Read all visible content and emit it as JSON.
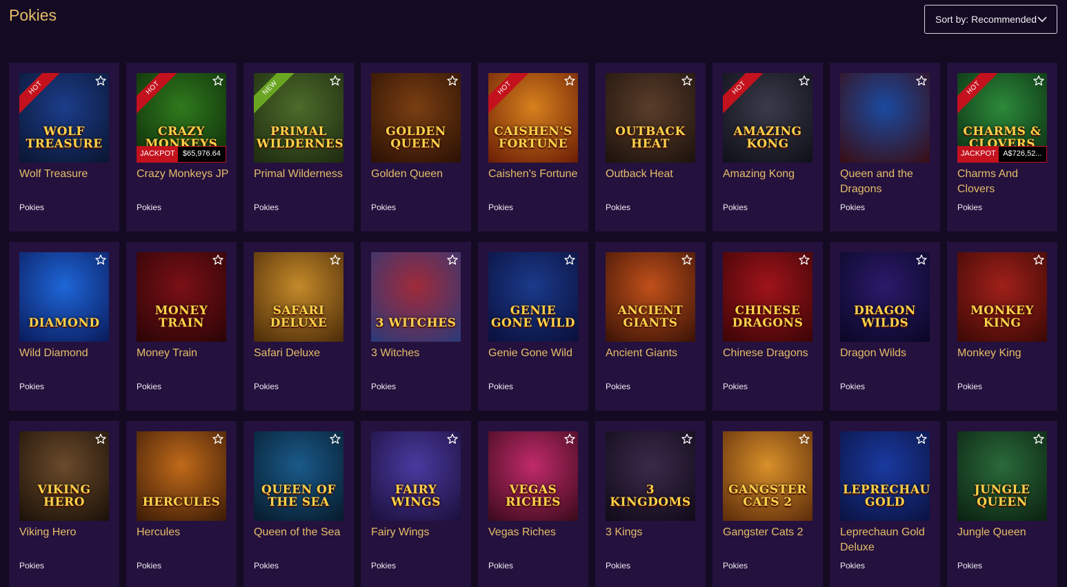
{
  "page": {
    "title": "Pokies",
    "sort_label": "Sort by: Recommended"
  },
  "colors": {
    "background": "#140a22",
    "card": "#24113d",
    "accent_gold": "#e6be69",
    "hot": "#c3121d",
    "new": "#6aa622"
  },
  "games": [
    {
      "name": "Wolf Treasure",
      "category": "Pokies",
      "badge": "HOT",
      "art_text": "Wolf Treasure",
      "bg": [
        "#1b3d8a",
        "#0a1530"
      ]
    },
    {
      "name": "Crazy Monkeys JP",
      "category": "Pokies",
      "badge": "HOT",
      "art_text": "Crazy Monkeys",
      "bg": [
        "#2f7a1c",
        "#0d2a0a"
      ],
      "jackpot_label": "JACKPOT",
      "jackpot_value": "$65,976.64"
    },
    {
      "name": "Primal Wilderness",
      "category": "Pokies",
      "badge": "NEW",
      "art_text": "Primal Wilderness",
      "bg": [
        "#4d6b2a",
        "#1d2a10"
      ]
    },
    {
      "name": "Golden Queen",
      "category": "Pokies",
      "badge": "",
      "art_text": "Golden Queen",
      "bg": [
        "#7a3f12",
        "#2a1004"
      ]
    },
    {
      "name": "Caishen's Fortune",
      "category": "Pokies",
      "badge": "HOT",
      "art_text": "Caishen's Fortune",
      "bg": [
        "#d7811e",
        "#6a1c05"
      ]
    },
    {
      "name": "Outback Heat",
      "category": "Pokies",
      "badge": "",
      "art_text": "Outback Heat",
      "bg": [
        "#5a3d2a",
        "#1c120c"
      ]
    },
    {
      "name": "Amazing Kong",
      "category": "Pokies",
      "badge": "HOT",
      "art_text": "Amazing Kong",
      "bg": [
        "#3a3a4a",
        "#0f0f18"
      ]
    },
    {
      "name": "Queen and the Dragons",
      "category": "Pokies",
      "badge": "",
      "art_text": "",
      "bg": [
        "#1b4aa0",
        "#3a0c12"
      ]
    },
    {
      "name": "Charms And Clovers",
      "category": "Pokies",
      "badge": "HOT",
      "art_text": "Charms & Clovers",
      "bg": [
        "#2c8a3a",
        "#0a2a10"
      ],
      "jackpot_label": "JACKPOT",
      "jackpot_value": "A$726,52..."
    },
    {
      "name": "Wild Diamond",
      "category": "Pokies",
      "badge": "",
      "art_text": "Diamond",
      "bg": [
        "#1e66d8",
        "#0a1a5a"
      ]
    },
    {
      "name": "Money Train",
      "category": "Pokies",
      "badge": "",
      "art_text": "Money Train",
      "bg": [
        "#7a1016",
        "#2a0406"
      ]
    },
    {
      "name": "Safari Deluxe",
      "category": "Pokies",
      "badge": "",
      "art_text": "Safari Deluxe",
      "bg": [
        "#c48a2a",
        "#4a2a08"
      ]
    },
    {
      "name": "3 Witches",
      "category": "Pokies",
      "badge": "",
      "art_text": "3 Witches",
      "bg": [
        "#a02a3a",
        "#2a3a7a"
      ]
    },
    {
      "name": "Genie Gone Wild",
      "category": "Pokies",
      "badge": "",
      "art_text": "Genie Gone Wild",
      "bg": [
        "#1a3a8a",
        "#0a0f3a"
      ]
    },
    {
      "name": "Ancient Giants",
      "category": "Pokies",
      "badge": "",
      "art_text": "Ancient Giants",
      "bg": [
        "#c0501a",
        "#3a1206"
      ]
    },
    {
      "name": "Chinese Dragons",
      "category": "Pokies",
      "badge": "",
      "art_text": "Chinese Dragons",
      "bg": [
        "#a0141a",
        "#3a0406"
      ]
    },
    {
      "name": "Dragon Wilds",
      "category": "Pokies",
      "badge": "",
      "art_text": "Dragon Wilds",
      "bg": [
        "#2a1a6a",
        "#0a0624"
      ]
    },
    {
      "name": "Monkey King",
      "category": "Pokies",
      "badge": "",
      "art_text": "Monkey King",
      "bg": [
        "#a0201a",
        "#3a0804"
      ]
    },
    {
      "name": "Viking Hero",
      "category": "Pokies",
      "badge": "",
      "art_text": "Viking Hero",
      "bg": [
        "#6a4a2a",
        "#1a1008"
      ]
    },
    {
      "name": "Hercules",
      "category": "Pokies",
      "badge": "",
      "art_text": "Hercules",
      "bg": [
        "#c06a1a",
        "#3a1a06"
      ]
    },
    {
      "name": "Queen of the Sea",
      "category": "Pokies",
      "badge": "",
      "art_text": "Queen of the Sea",
      "bg": [
        "#1a5a8a",
        "#061a2a"
      ]
    },
    {
      "name": "Fairy Wings",
      "category": "Pokies",
      "badge": "",
      "art_text": "Fairy Wings",
      "bg": [
        "#4a3aa0",
        "#1a0f3a"
      ]
    },
    {
      "name": "Vegas Riches",
      "category": "Pokies",
      "badge": "",
      "art_text": "Vegas Riches",
      "bg": [
        "#c02a6a",
        "#3a0a1a"
      ]
    },
    {
      "name": "3 Kings",
      "category": "Pokies",
      "badge": "",
      "art_text": "3 Kingdoms",
      "bg": [
        "#3a2a4a",
        "#100a18"
      ]
    },
    {
      "name": "Gangster Cats 2",
      "category": "Pokies",
      "badge": "",
      "art_text": "Gangster Cats 2",
      "bg": [
        "#d8902a",
        "#5a2a0a"
      ]
    },
    {
      "name": "Leprechaun Gold Deluxe",
      "category": "Pokies",
      "badge": "",
      "art_text": "Leprechaun Gold",
      "bg": [
        "#1a3aa0",
        "#0a1240"
      ]
    },
    {
      "name": "Jungle Queen",
      "category": "Pokies",
      "badge": "",
      "art_text": "Jungle Queen",
      "bg": [
        "#2a6a3a",
        "#0a2010"
      ]
    }
  ]
}
